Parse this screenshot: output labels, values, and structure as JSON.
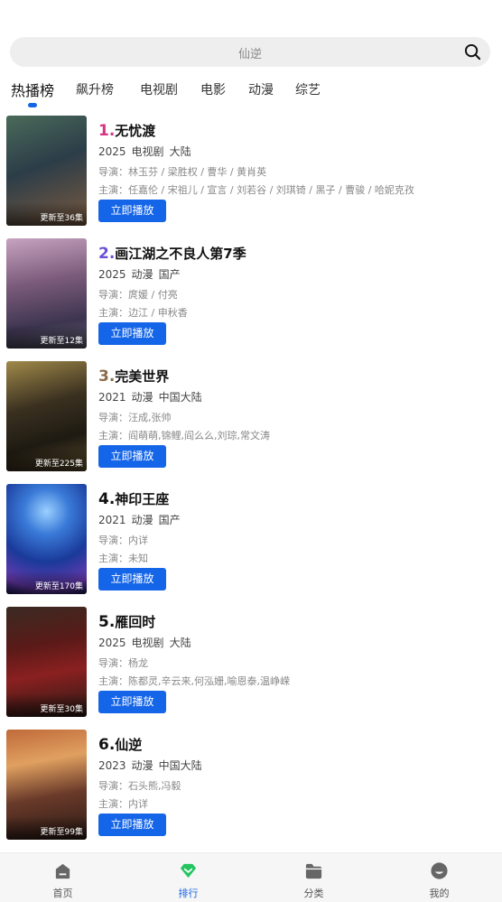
{
  "search": {
    "placeholder": "仙逆"
  },
  "tabs": [
    {
      "label": "热播榜",
      "active": true
    },
    {
      "label": "飙升榜"
    },
    {
      "label": "电视剧"
    },
    {
      "label": "电影"
    },
    {
      "label": "动漫"
    },
    {
      "label": "综艺"
    }
  ],
  "colors": {
    "accent": "#1565e8",
    "rank1": "#d63384",
    "rank2": "#6c4ed8",
    "rank3": "#8a6a4a",
    "rank_default": "#111111"
  },
  "list": [
    {
      "rank": "1.",
      "title": "无忧渡",
      "year": "2025",
      "type": "电视剧",
      "region": "大陆",
      "director": "导演：林玉芬 / 梁胜权 / 曹华 / 黄肖英",
      "cast": "主演：任嘉伦 / 宋祖儿 / 宣言 / 刘若谷 / 刘琪锜 / 黑子 / 曹骏 / 哈妮克孜",
      "episodes": "更新至36集",
      "play_label": "立即播放"
    },
    {
      "rank": "2.",
      "title": "画江湖之不良人第7季",
      "year": "2025",
      "type": "动漫",
      "region": "国产",
      "director": "导演：庹媛 / 付亮",
      "cast": "主演：边江 / 申秋香",
      "episodes": "更新至12集",
      "play_label": "立即播放"
    },
    {
      "rank": "3.",
      "title": "完美世界",
      "year": "2021",
      "type": "动漫",
      "region": "中国大陆",
      "director": "导演：汪成,张帅",
      "cast": "主演：阎萌萌,锦鲤,阎么么,刘琮,常文涛",
      "episodes": "更新至225集",
      "play_label": "立即播放"
    },
    {
      "rank": "4.",
      "title": "神印王座",
      "year": "2021",
      "type": "动漫",
      "region": "国产",
      "director": "导演：内详",
      "cast": "主演：未知",
      "episodes": "更新至170集",
      "play_label": "立即播放"
    },
    {
      "rank": "5.",
      "title": "雁回时",
      "year": "2025",
      "type": "电视剧",
      "region": "大陆",
      "director": "导演：杨龙",
      "cast": "主演：陈都灵,辛云来,何泓姗,喻恩泰,温峥嵘",
      "episodes": "更新至30集",
      "play_label": "立即播放"
    },
    {
      "rank": "6.",
      "title": "仙逆",
      "year": "2023",
      "type": "动漫",
      "region": "中国大陆",
      "director": "导演：石头熊,冯毅",
      "cast": "主演：内详",
      "episodes": "更新至99集",
      "play_label": "立即播放"
    }
  ],
  "bottom_nav": [
    {
      "label": "首页",
      "icon": "home-icon"
    },
    {
      "label": "排行",
      "icon": "ranking-icon",
      "active": true
    },
    {
      "label": "分类",
      "icon": "category-icon"
    },
    {
      "label": "我的",
      "icon": "profile-icon"
    }
  ]
}
